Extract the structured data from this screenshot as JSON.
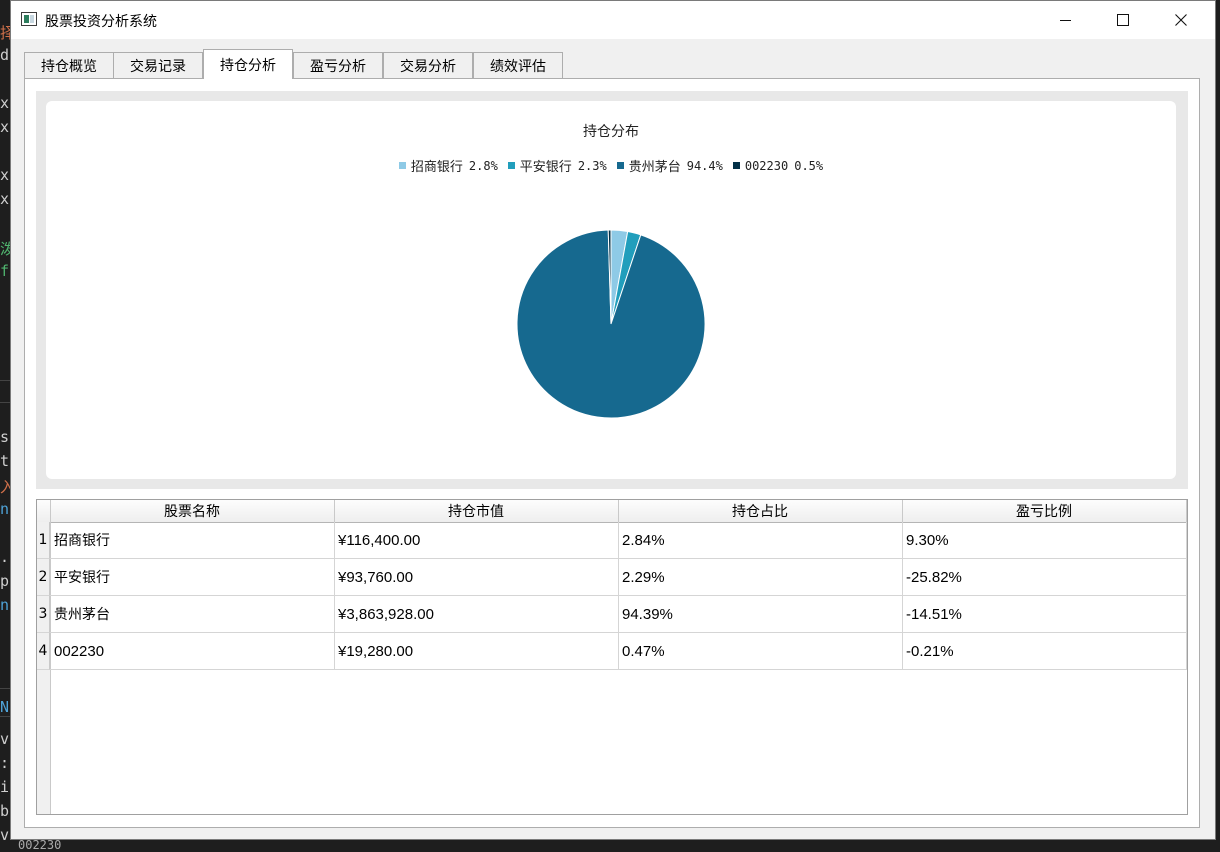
{
  "window": {
    "title": "股票投资分析系统"
  },
  "tabs": [
    {
      "label": "持仓概览",
      "active": false
    },
    {
      "label": "交易记录",
      "active": false
    },
    {
      "label": "持仓分析",
      "active": true
    },
    {
      "label": "盈亏分析",
      "active": false
    },
    {
      "label": "交易分析",
      "active": false
    },
    {
      "label": "绩效评估",
      "active": false
    }
  ],
  "chart_data": {
    "type": "pie",
    "title": "持仓分布",
    "legend_position": "top",
    "slices": [
      {
        "label": "招商银行",
        "percent_label": "2.8%",
        "value": 2.84,
        "color": "#8ecae6"
      },
      {
        "label": "平安银行",
        "percent_label": "2.3%",
        "value": 2.29,
        "color": "#219ebc"
      },
      {
        "label": "贵州茅台",
        "percent_label": "94.4%",
        "value": 94.39,
        "color": "#16698f"
      },
      {
        "label": "002230",
        "percent_label": "0.5%",
        "value": 0.47,
        "color": "#023047"
      }
    ]
  },
  "table": {
    "columns": [
      "股票名称",
      "持仓市值",
      "持仓占比",
      "盈亏比例"
    ],
    "rows": [
      {
        "num": "1",
        "cells": [
          "招商银行",
          "¥116,400.00",
          "2.84%",
          "9.30%"
        ]
      },
      {
        "num": "2",
        "cells": [
          "平安银行",
          "¥93,760.00",
          "2.29%",
          "-25.82%"
        ]
      },
      {
        "num": "3",
        "cells": [
          "贵州茅台",
          "¥3,863,928.00",
          "94.39%",
          "-14.51%"
        ]
      },
      {
        "num": "4",
        "cells": [
          "002230",
          "¥19,280.00",
          "0.47%",
          "-0.21%"
        ]
      }
    ]
  },
  "background": {
    "fragments": [
      "择",
      "d",
      "x",
      "x",
      "x",
      "x",
      "泼",
      "f",
      "s",
      "t",
      "入",
      "n",
      ".",
      "p",
      "n",
      "N",
      "v",
      ":",
      "i",
      "b",
      "v"
    ],
    "bottom_text": "002230"
  }
}
